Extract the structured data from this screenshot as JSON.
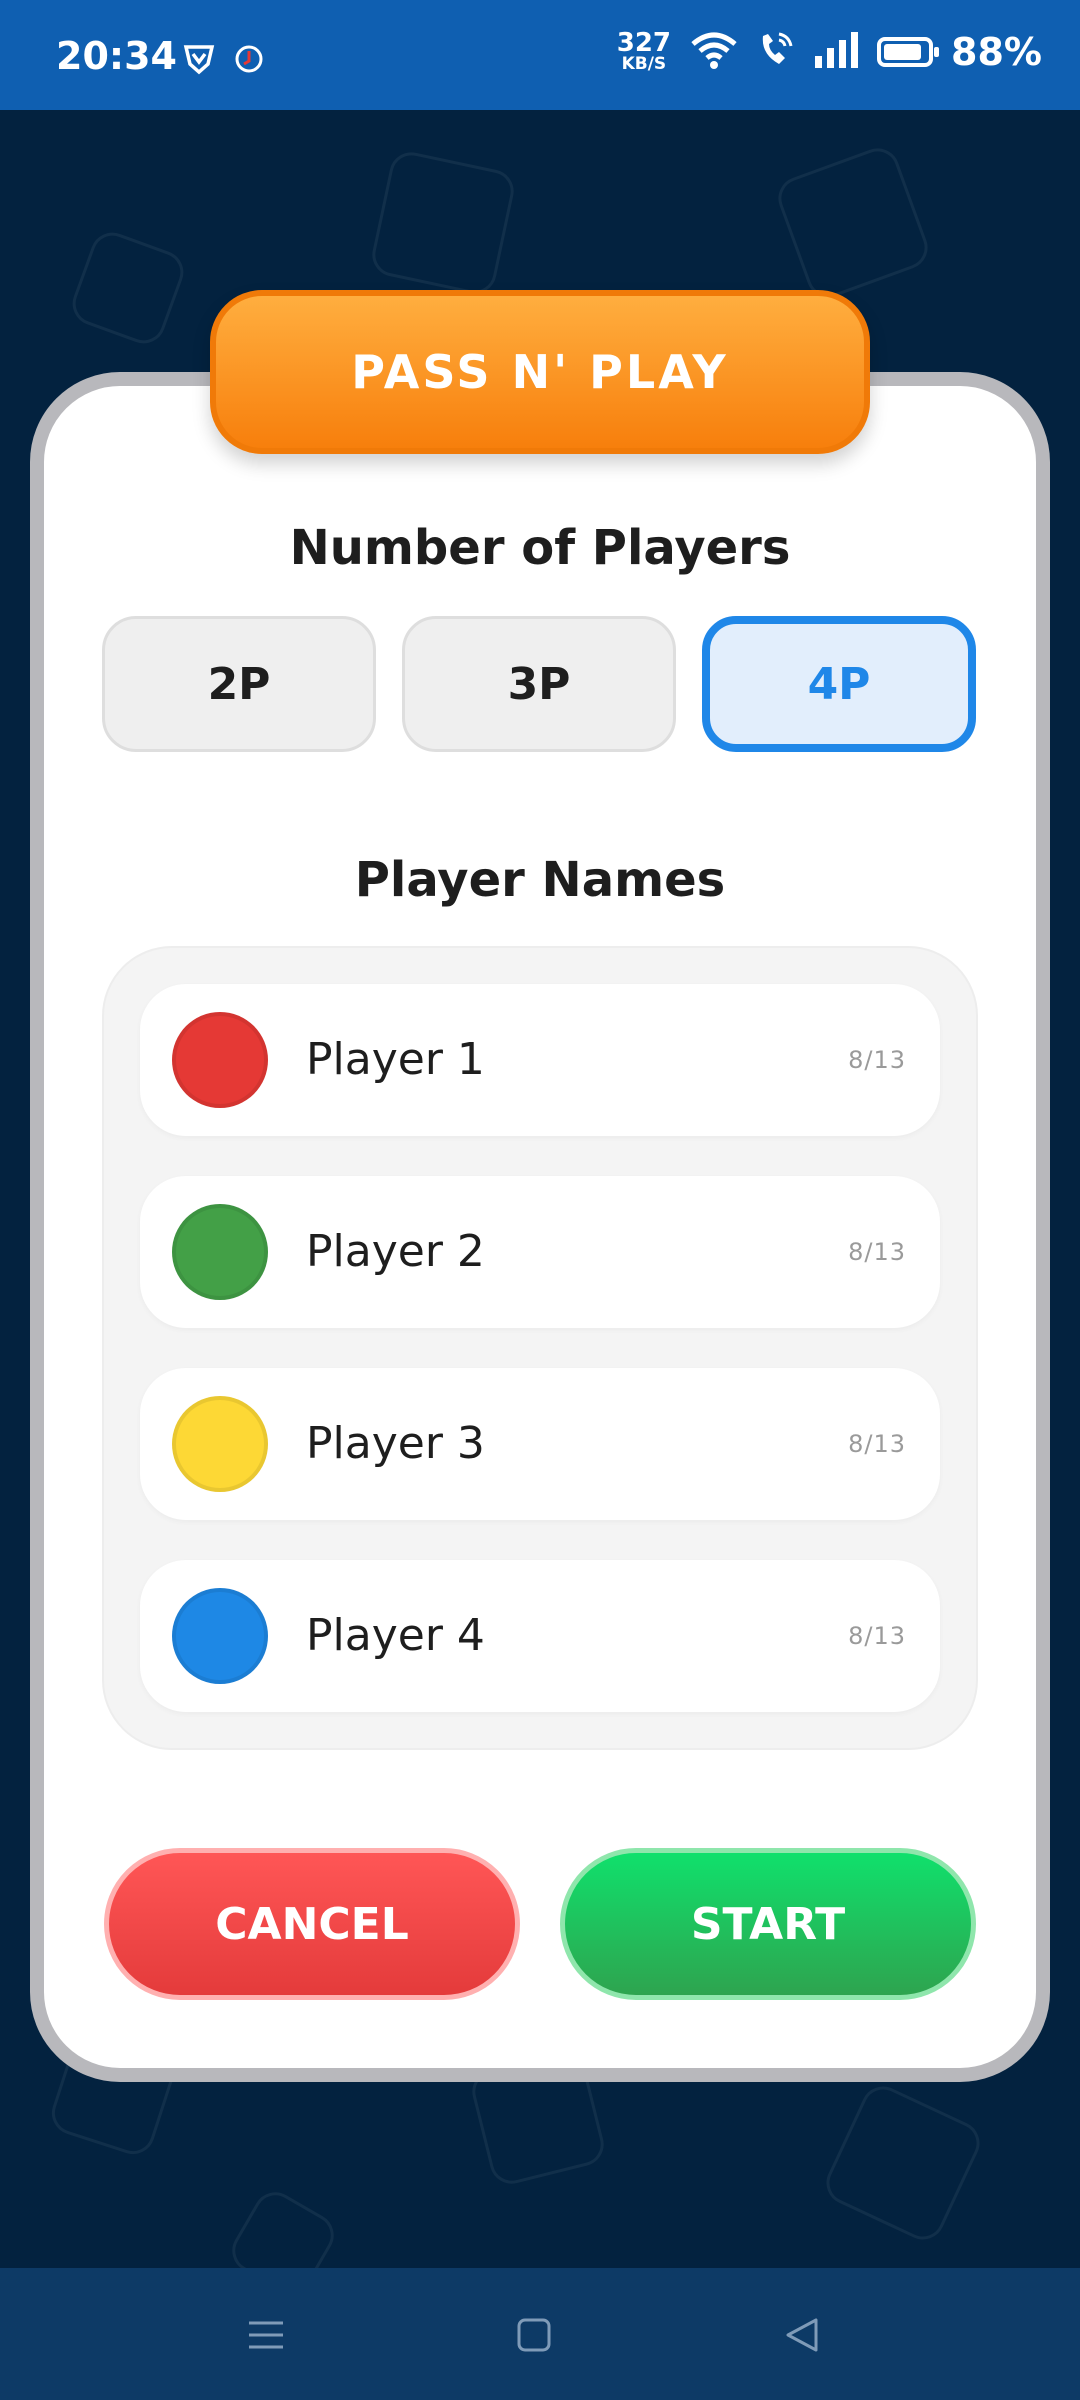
{
  "status_bar": {
    "time": "20:34",
    "network_speed_value": "327",
    "network_speed_unit": "KB/S",
    "battery_percent": "88%",
    "battery_level": 0.88,
    "icons": [
      "vpn-shield-icon",
      "notification-icon",
      "wifi-icon",
      "wifi-call-icon",
      "signal-icon",
      "battery-icon"
    ]
  },
  "dialog": {
    "title": "PASS N' PLAY",
    "players_heading": "Number of Players",
    "player_count_options": [
      "2P",
      "3P",
      "4P"
    ],
    "selected_player_count": "4P",
    "names_heading": "Player Names",
    "players": [
      {
        "name": "Player 1",
        "counter": "8/13",
        "color": "#e53935"
      },
      {
        "name": "Player 2",
        "counter": "8/13",
        "color": "#43a047"
      },
      {
        "name": "Player 3",
        "counter": "8/13",
        "color": "#fdd835"
      },
      {
        "name": "Player 4",
        "counter": "8/13",
        "color": "#1e88e5"
      }
    ],
    "cancel_label": "CANCEL",
    "start_label": "START"
  },
  "colors": {
    "background": "#03223f",
    "title_orange": "#f7820f",
    "selected_blue": "#1f87e8",
    "cancel_red": "#e43b3b",
    "start_green": "#2ea44f"
  },
  "nav_bar": {
    "icons": [
      "menu-icon",
      "home-square-icon",
      "back-triangle-icon"
    ]
  }
}
